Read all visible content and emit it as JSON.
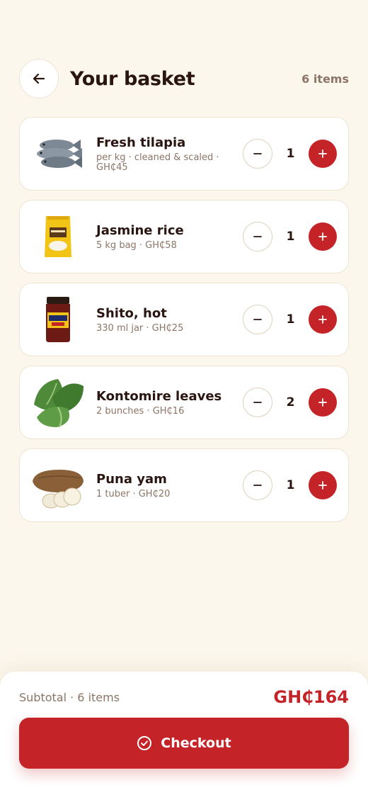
{
  "header": {
    "title": "Your basket",
    "item_count": "6 items"
  },
  "items": [
    {
      "name": "Fresh tilapia",
      "meta": "per kg · cleaned & scaled · GH₵45",
      "qty": "1",
      "icon": "fish-image"
    },
    {
      "name": "Jasmine rice",
      "meta": "5 kg bag · GH₵58",
      "qty": "1",
      "icon": "rice-bag-image"
    },
    {
      "name": "Shito, hot",
      "meta": "330 ml jar · GH₵25",
      "qty": "1",
      "icon": "shito-jar-image"
    },
    {
      "name": "Kontomire leaves",
      "meta": "2 bunches · GH₵16",
      "qty": "2",
      "icon": "leaves-image"
    },
    {
      "name": "Puna yam",
      "meta": "1 tuber · GH₵20",
      "qty": "1",
      "icon": "yam-image"
    }
  ],
  "footer": {
    "subtotal_label": "Subtotal · 6 items",
    "subtotal_value": "GH₵164",
    "checkout_label": "Checkout"
  },
  "colors": {
    "accent": "#c42428",
    "background": "#fcf7ec",
    "text": "#2a1510",
    "muted": "#8c7566"
  }
}
